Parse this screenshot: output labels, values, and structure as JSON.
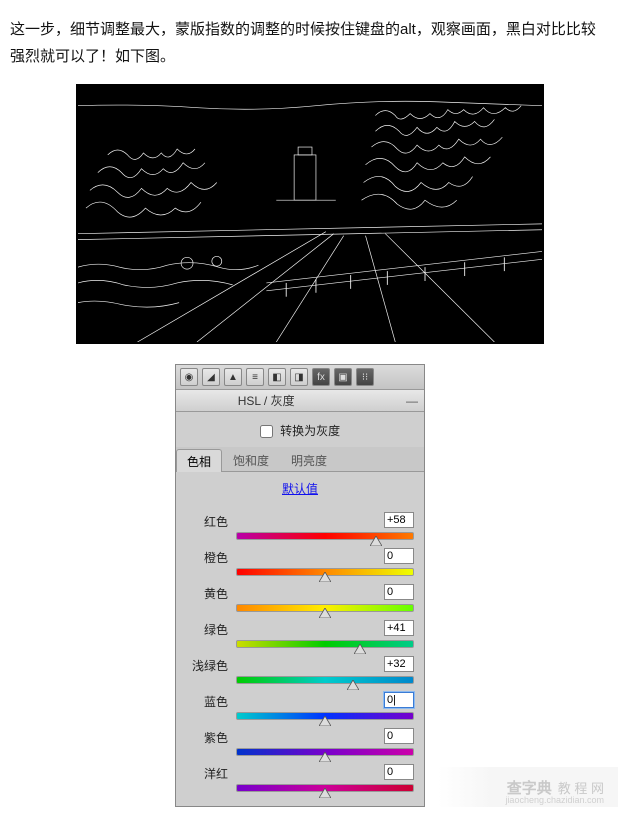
{
  "article": {
    "text": "这一步，细节调整最大，蒙版指数的调整的时候按住键盘的alt，观察画面，黑白对比比较强烈就可以了！如下图。"
  },
  "panel": {
    "title": "HSL / 灰度",
    "toolbar_icons": [
      "aperture",
      "histogram",
      "triangle",
      "lines",
      "split",
      "fx-dark",
      "camera-dark",
      "sliders-dark"
    ],
    "convert_label": "转换为灰度",
    "convert_checked": false,
    "tabs": [
      {
        "label": "色相",
        "active": true
      },
      {
        "label": "饱和度",
        "active": false
      },
      {
        "label": "明亮度",
        "active": false
      }
    ],
    "defaults_label": "默认值",
    "sliders": [
      {
        "name": "红色",
        "value": "+58",
        "pct": 79,
        "grad": "linear-gradient(to right,#b800a8,#ff0000,#ff7a00)"
      },
      {
        "name": "橙色",
        "value": "0",
        "pct": 50,
        "grad": "linear-gradient(to right,#ff0000,#ff8800,#eeff00)"
      },
      {
        "name": "黄色",
        "value": "0",
        "pct": 50,
        "grad": "linear-gradient(to right,#ff8800,#ffee00,#66ff00)"
      },
      {
        "name": "绿色",
        "value": "+41",
        "pct": 70,
        "grad": "linear-gradient(to right,#ccdd00,#00cc00,#00cc88)"
      },
      {
        "name": "浅绿色",
        "value": "+32",
        "pct": 66,
        "grad": "linear-gradient(to right,#00cc00,#00cccc,#0088cc)"
      },
      {
        "name": "蓝色",
        "value": "0",
        "pct": 50,
        "grad": "linear-gradient(to right,#00cccc,#0033ff,#7700cc)",
        "active": true,
        "display": "0|"
      },
      {
        "name": "紫色",
        "value": "0",
        "pct": 50,
        "grad": "linear-gradient(to right,#0033cc,#7700cc,#cc00aa)"
      },
      {
        "name": "洋红",
        "value": "0",
        "pct": 50,
        "grad": "linear-gradient(to right,#7700cc,#cc0099,#cc0033)"
      }
    ]
  },
  "watermark": {
    "brand": "查字典",
    "sub": "教 程 网",
    "url": "jiaocheng.chazidian.com"
  }
}
